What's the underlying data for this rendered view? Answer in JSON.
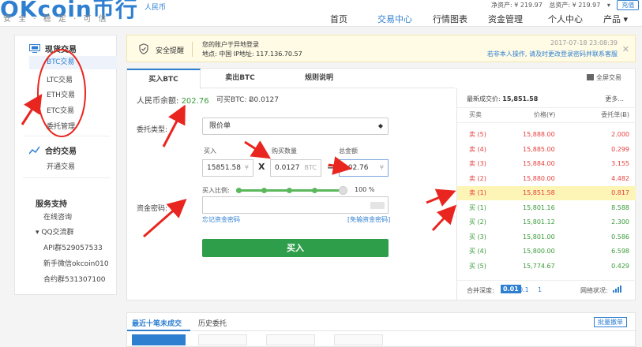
{
  "header": {
    "logo": "OKcoin币行",
    "logo_sub": "人民币",
    "slogan": "安 全 · 稳 定 · 可 信",
    "net_assets": "净资产: ¥ 219.97",
    "total_assets": "总资产: ¥ 219.97",
    "recharge": "充值",
    "nav": [
      "首页",
      "交易中心",
      "行情图表",
      "资金管理",
      "个人中心",
      "产品 ▾"
    ],
    "active_nav": "交易中心"
  },
  "sidebar": {
    "spot_title": "现货交易",
    "spot_items": [
      "BTC交易",
      "LTC交易",
      "ETH交易",
      "ETC交易",
      "委托管理"
    ],
    "selected": "BTC交易",
    "contract_title": "合约交易",
    "contract_items": [
      "开通交易"
    ],
    "service_title": "服务支持",
    "service_items": [
      "在线咨询",
      "QQ交流群",
      "API群529057533",
      "新手微信okcoin010",
      "合约群531307100"
    ]
  },
  "warning": {
    "title": "安全提醒",
    "line1": "您的账户于异地登录",
    "line2": "地点: 中国    IP地址: 117.136.70.57",
    "time": "2017-07-18 23:08:39",
    "action": "若非本人操作, 请及时更改登录密码并联系客服"
  },
  "trade": {
    "tabs": [
      "买入BTC",
      "卖出BTC",
      "规则说明"
    ],
    "active_tab": "买入BTC",
    "fullscreen": "全屏交易",
    "balance_label": "人民币余额:",
    "balance_value": "202.76",
    "available_label": "可买BTC:",
    "available_value": "Ƀ0.0127",
    "order_type_label": "委托类型:",
    "order_type_value": "限价单",
    "price_label": "买入",
    "price_value": "15851.58",
    "price_unit": "¥",
    "qty_label": "购买数量",
    "qty_value": "0.0127",
    "qty_unit": "BTC",
    "total_label": "总金额",
    "total_value": "202.76",
    "total_unit": "¥",
    "multiply": "X",
    "equals": "=",
    "ratio_label": "买入比例:",
    "ratio_pct": "100 %",
    "ratio_fraction": 1.0,
    "password_label": "资金密码:",
    "forgot": "忘记资金密码",
    "no_password": "[免输资金密码]",
    "buy_button": "买入"
  },
  "orderbook": {
    "last_label": "最新成交价:",
    "last_price": "15,851.58",
    "more": "更多...",
    "headers": [
      "买卖",
      "价格(¥)",
      "委托单(Ƀ)"
    ],
    "rows": [
      {
        "side": "卖 (5)",
        "price": "15,888.00",
        "amount": "2.000",
        "type": "sell"
      },
      {
        "side": "卖 (4)",
        "price": "15,885.00",
        "amount": "0.299",
        "type": "sell"
      },
      {
        "side": "卖 (3)",
        "price": "15,884.00",
        "amount": "3.155",
        "type": "sell"
      },
      {
        "side": "卖 (2)",
        "price": "15,880.00",
        "amount": "4.482",
        "type": "sell"
      },
      {
        "side": "卖 (1)",
        "price": "15,851.58",
        "amount": "0.817",
        "type": "sell"
      },
      {
        "side": "买 (1)",
        "price": "15,801.16",
        "amount": "8.588",
        "type": "buy"
      },
      {
        "side": "买 (2)",
        "price": "15,801.12",
        "amount": "2.300",
        "type": "buy"
      },
      {
        "side": "买 (3)",
        "price": "15,801.00",
        "amount": "0.586",
        "type": "buy"
      },
      {
        "side": "买 (4)",
        "price": "15,800.00",
        "amount": "6.598",
        "type": "buy"
      },
      {
        "side": "买 (5)",
        "price": "15,774.67",
        "amount": "0.429",
        "type": "buy"
      }
    ],
    "depth_label": "合并深度:",
    "depth_options": [
      "0.01",
      "0.1",
      "1"
    ],
    "network_label": "网络状况:"
  },
  "bottom": {
    "tabs": [
      "最近十笔未成交",
      "历史委托"
    ],
    "batch_cancel": "批量撤单"
  },
  "colors": {
    "accent": "#2f7fd1",
    "buy_green": "#2e9e4a",
    "sell_red": "#e64040",
    "annotation_red": "#e8261f",
    "highlight": "#fcf5b6"
  }
}
